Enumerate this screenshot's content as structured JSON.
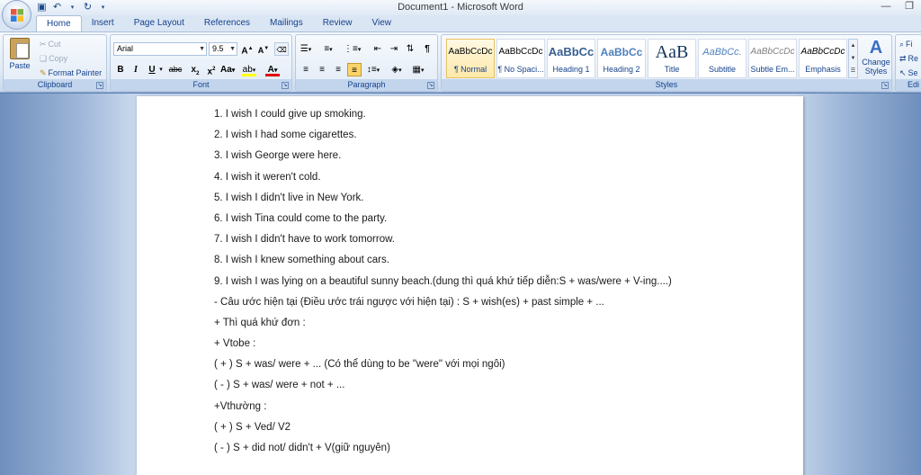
{
  "window": {
    "title": "Document1 - Microsoft Word"
  },
  "tabs": [
    "Home",
    "Insert",
    "Page Layout",
    "References",
    "Mailings",
    "Review",
    "View"
  ],
  "clipboard": {
    "paste": "Paste",
    "cut": "Cut",
    "copy": "Copy",
    "format_painter": "Format Painter",
    "label": "Clipboard"
  },
  "font": {
    "name": "Arial",
    "size": "9.5",
    "label": "Font"
  },
  "paragraph": {
    "label": "Paragraph"
  },
  "styles": {
    "label": "Styles",
    "items": [
      {
        "sample": "AaBbCcDc",
        "name": "¶ Normal"
      },
      {
        "sample": "AaBbCcDc",
        "name": "¶ No Spaci..."
      },
      {
        "sample": "AaBbCc",
        "name": "Heading 1"
      },
      {
        "sample": "AaBbCc",
        "name": "Heading 2"
      },
      {
        "sample": "AaB",
        "name": "Title"
      },
      {
        "sample": "AaBbCc.",
        "name": "Subtitle"
      },
      {
        "sample": "AaBbCcDc",
        "name": "Subtle Em..."
      },
      {
        "sample": "AaBbCcDc",
        "name": "Emphasis"
      }
    ],
    "change_styles": "Change Styles"
  },
  "editing": {
    "label": "Edi",
    "find": "Fi",
    "replace": "Re",
    "select": "Se"
  },
  "document": {
    "lines": [
      "1. I wish I could give up smoking.",
      "2. I wish I had some cigarettes.",
      "3. I wish George were here.",
      "4. I wish it weren't cold.",
      "5. I wish I didn't live in New York.",
      "6. I wish Tina could come to the party.",
      "7. I wish I didn't have to work tomorrow.",
      "8. I wish I knew something about cars.",
      "9. I wish I was lying on a beautiful sunny beach.(dung thì quá khứ tiếp diễn:S + was/were + V-ing....)",
      "- Câu ước hiện tại (Điều ước trái ngược với hiện tại) : S + wish(es) + past simple + ...",
      "+ Thì quá khứ đơn :",
      "+ Vtobe :",
      "( + ) S + was/ were + ... (Có thể dùng to be \"were\" với mọi ngôi)",
      "( - ) S + was/ were + not + ...",
      "+Vthường :",
      "( + ) S + Ved/ V2",
      "( - ) S + did not/ didn't + V(giữ nguyên)"
    ]
  }
}
